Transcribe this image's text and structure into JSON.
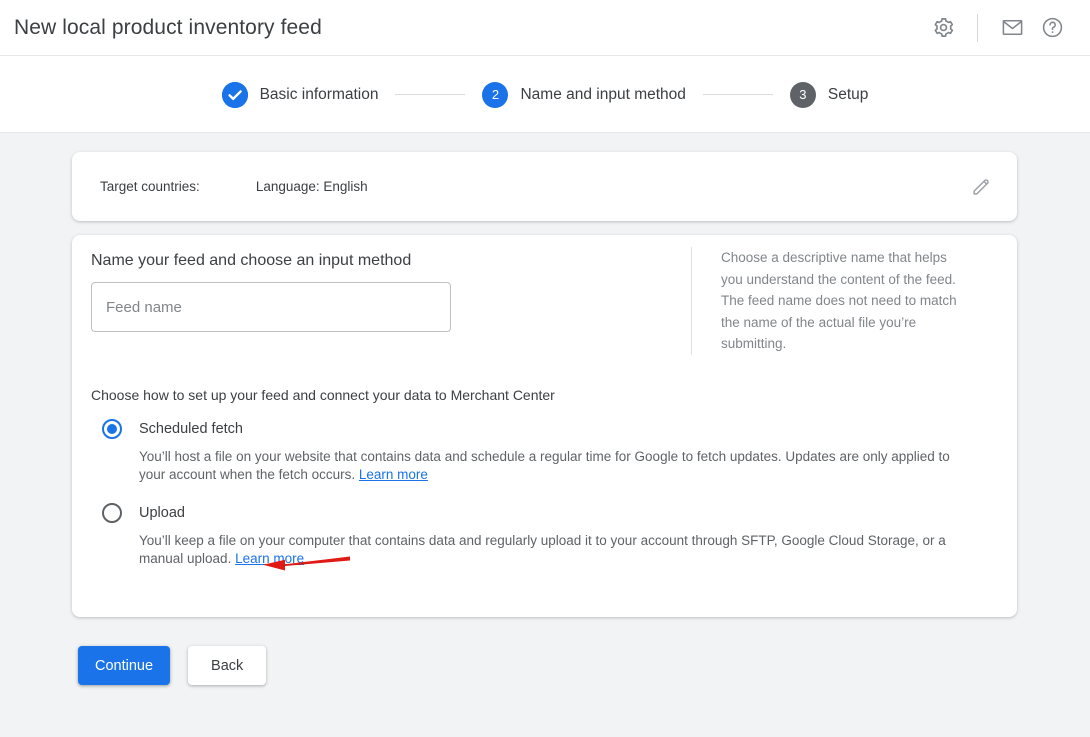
{
  "header": {
    "title": "New local product inventory feed",
    "icons": [
      {
        "name": "gear-icon",
        "label": "Settings"
      },
      {
        "name": "mail-icon",
        "label": "Messages"
      },
      {
        "name": "help-icon",
        "label": "Help"
      }
    ]
  },
  "stepper": {
    "steps": [
      {
        "marker": "check",
        "label": "Basic information",
        "state": "done"
      },
      {
        "marker": "2",
        "label": "Name and input method",
        "state": "active"
      },
      {
        "marker": "3",
        "label": "Setup",
        "state": "idle"
      }
    ]
  },
  "summary": {
    "target_countries_label": "Target countries:",
    "language_label": "Language: English",
    "edit_icon": "pencil-icon"
  },
  "main": {
    "section_title": "Name your feed and choose an input method",
    "feed_name_placeholder": "Feed name",
    "feed_name_value": "",
    "helper_text": "Choose a descriptive name that helps you understand the content of the feed. The feed name does not need to match the name of the actual file you’re submitting.",
    "choose_label": "Choose how to set up your feed and connect your data to Merchant Center",
    "options": [
      {
        "label": "Scheduled fetch",
        "selected": true,
        "description": "You’ll host a file on your website that contains data and schedule a regular time for Google to fetch updates. Updates are only applied to your account when the fetch occurs.",
        "link_label": "Learn more"
      },
      {
        "label": "Upload",
        "selected": false,
        "description": "You’ll keep a file on your computer that contains data and regularly upload it to your account through SFTP, Google Cloud Storage, or a manual upload.",
        "link_label": "Learn more"
      }
    ]
  },
  "footer": {
    "continue_label": "Continue",
    "back_label": "Back"
  },
  "annotation": {
    "arrow_color": "#e01b14",
    "points_to": "Scheduled fetch"
  },
  "colors": {
    "accent": "#1a73e8",
    "idle_step": "#5f6368",
    "page_background": "#f1f3f4",
    "card_background": "#ffffff",
    "text_primary": "#3c4043",
    "text_secondary": "#5f6368",
    "placeholder": "#80868b",
    "link": "#1a73e8"
  }
}
